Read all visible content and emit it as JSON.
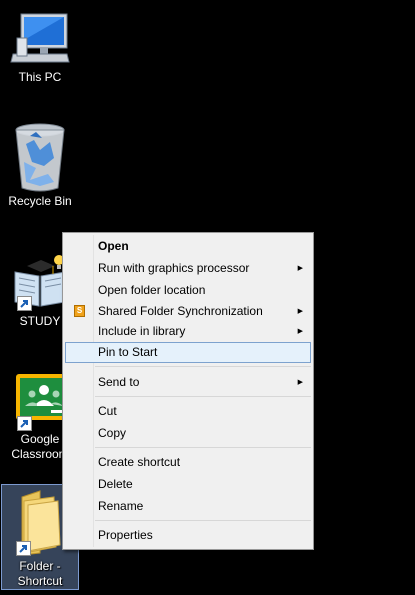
{
  "desktop": {
    "icons": [
      {
        "label": "This PC"
      },
      {
        "label": "Recycle Bin"
      },
      {
        "label": "STUDY"
      },
      {
        "label_line1": "Google",
        "label_line2": "Classroom"
      },
      {
        "label_line1": "Folder -",
        "label_line2": "Shortcut"
      }
    ]
  },
  "context_menu": {
    "items": [
      {
        "label": "Open"
      },
      {
        "label": "Run with graphics processor"
      },
      {
        "label": "Open folder location"
      },
      {
        "label": "Shared Folder Synchronization",
        "icon_text": "S"
      },
      {
        "label": "Include in library"
      },
      {
        "label": "Pin to Start"
      },
      {
        "label": "Send to"
      },
      {
        "label": "Cut"
      },
      {
        "label": "Copy"
      },
      {
        "label": "Create shortcut"
      },
      {
        "label": "Delete"
      },
      {
        "label": "Rename"
      },
      {
        "label": "Properties"
      }
    ],
    "submenu_arrow": "▶"
  },
  "colors": {
    "desktop_bg": "#000000",
    "menu_bg": "#f0f0f0",
    "highlight_bg": "#e5f1fb",
    "highlight_border": "#7da2ce"
  }
}
